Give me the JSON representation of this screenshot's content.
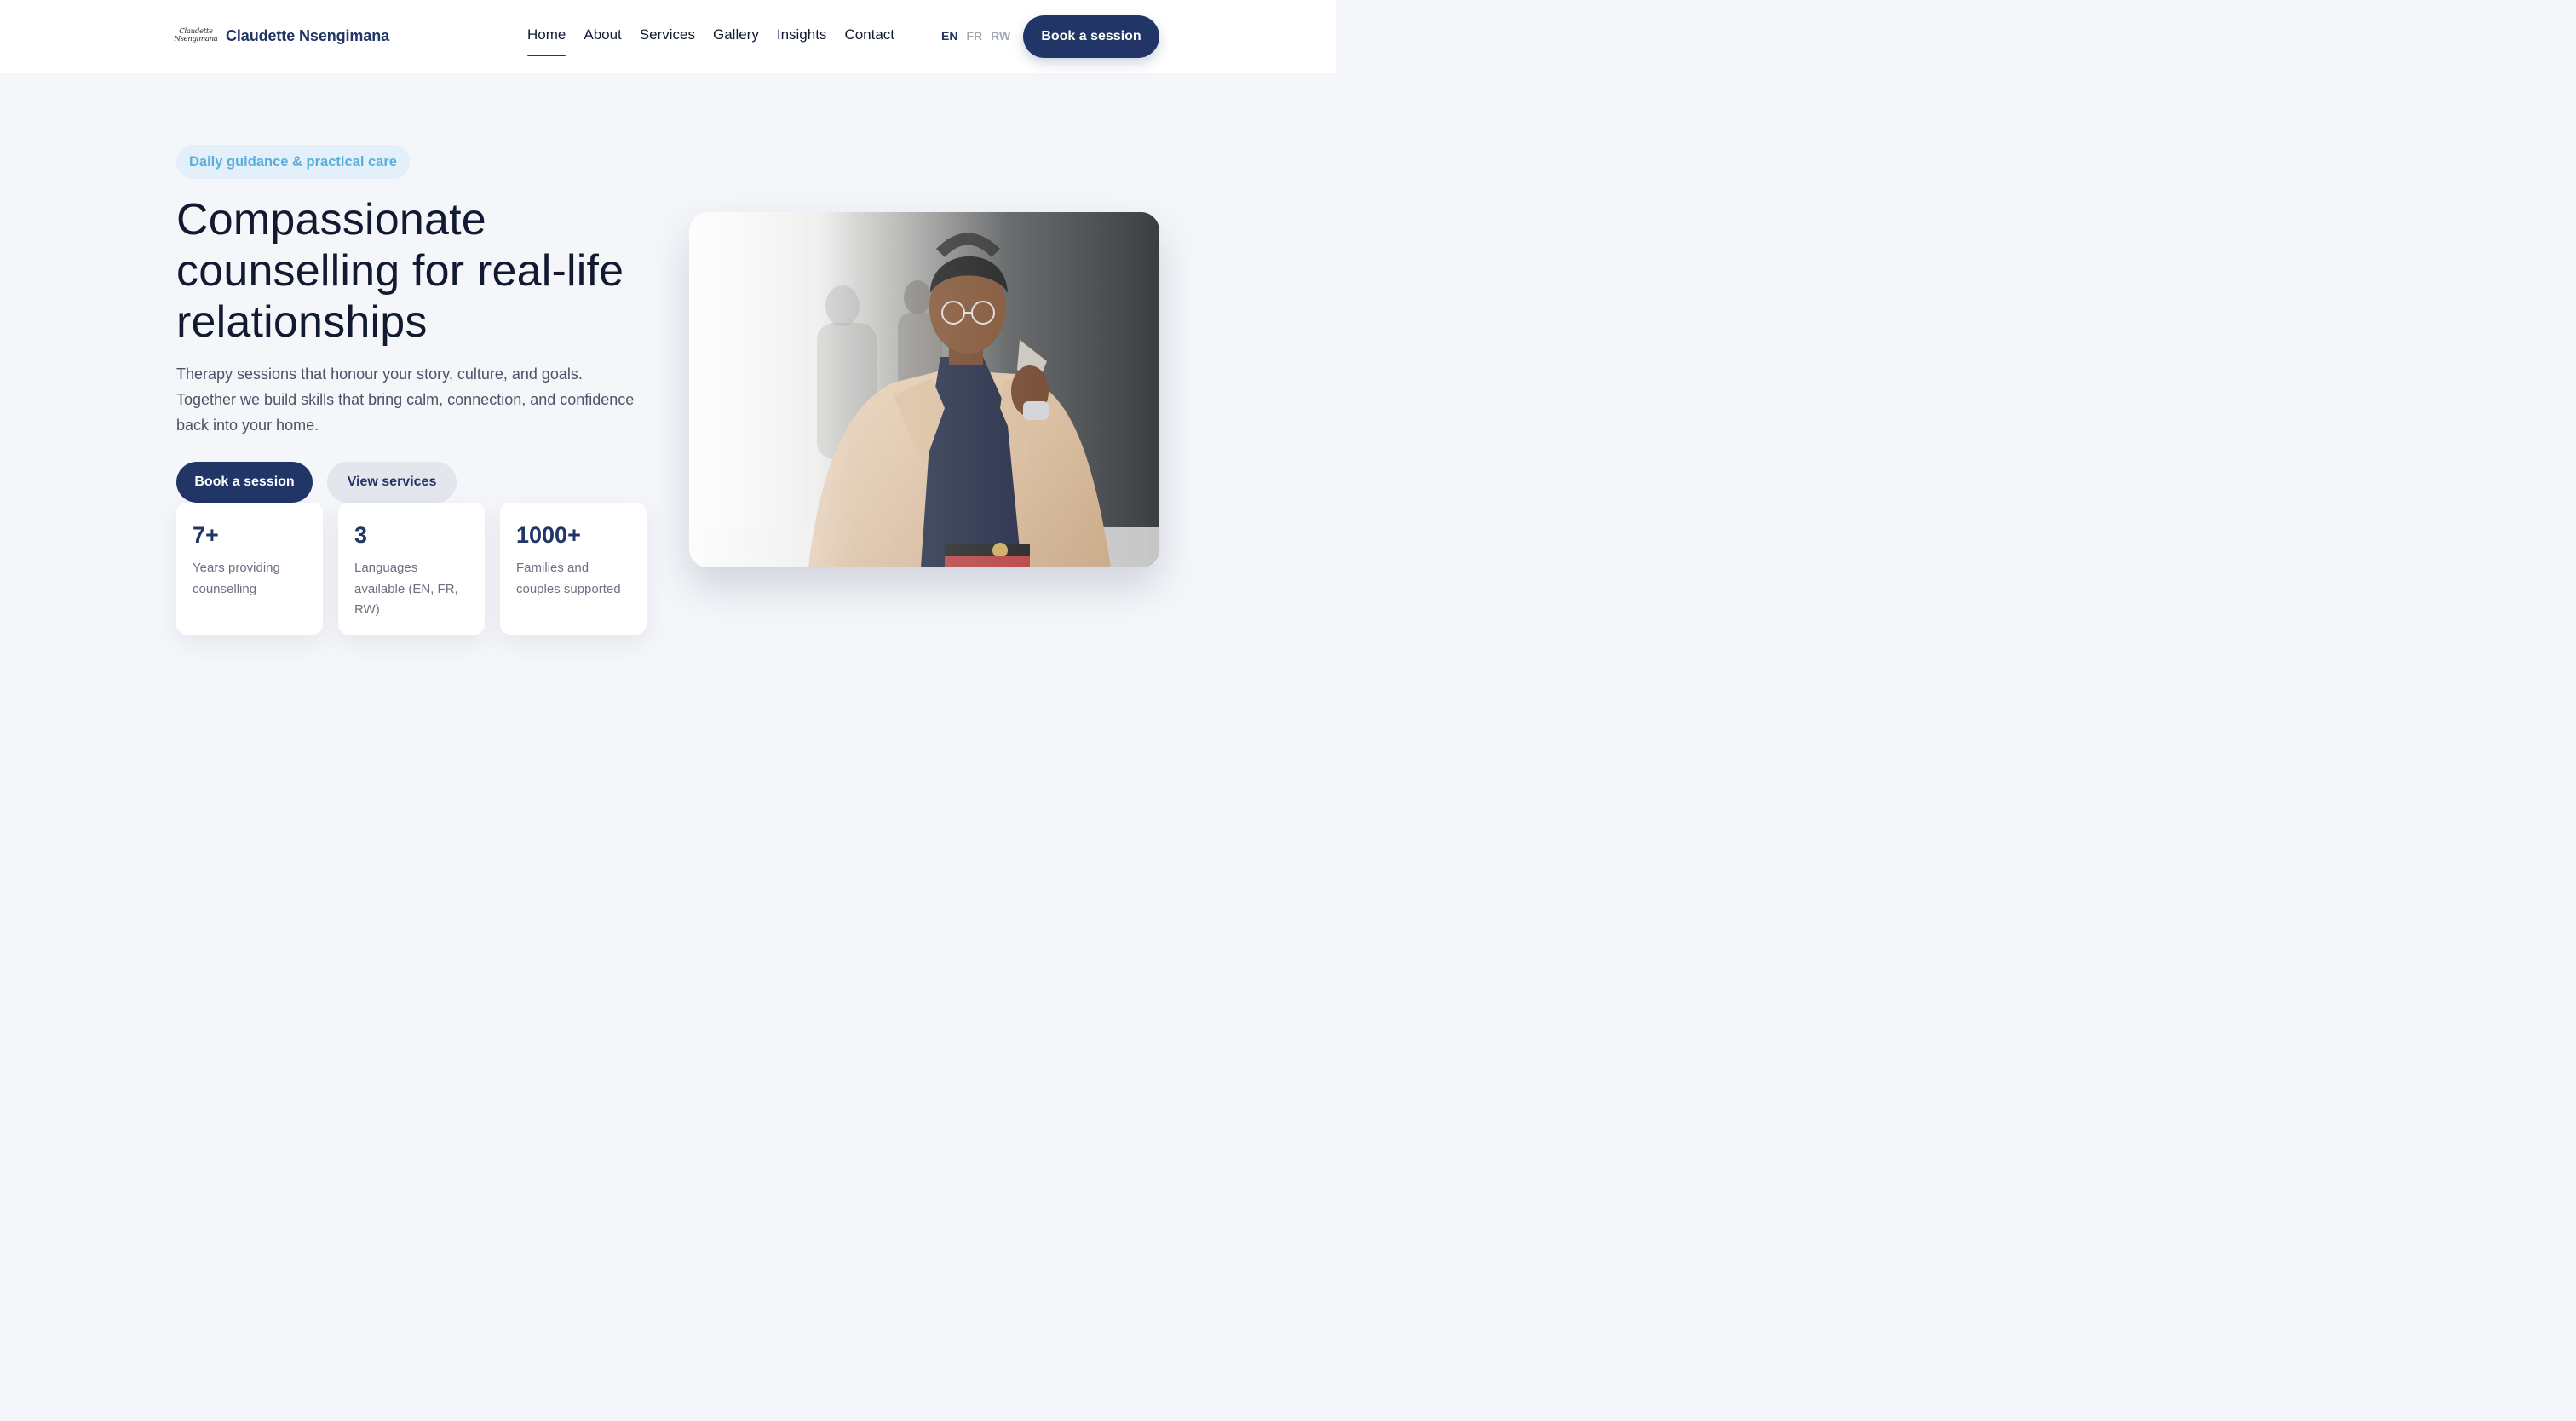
{
  "header": {
    "logo_text": "Claudette Nsengimana",
    "brand_name": "Claudette Nsengimana",
    "nav": [
      {
        "label": "Home",
        "active": true
      },
      {
        "label": "About",
        "active": false
      },
      {
        "label": "Services",
        "active": false
      },
      {
        "label": "Gallery",
        "active": false
      },
      {
        "label": "Insights",
        "active": false
      },
      {
        "label": "Contact",
        "active": false
      }
    ],
    "languages": [
      {
        "label": "EN",
        "active": true
      },
      {
        "label": "FR",
        "active": false
      },
      {
        "label": "RW",
        "active": false
      }
    ],
    "cta_label": "Book a session"
  },
  "hero": {
    "tag": "Daily guidance & practical care",
    "title": "Compassionate counselling for real-life relationships",
    "subtitle": "Therapy sessions that honour your story, culture, and goals. Together we build skills that bring calm, connection, and confidence back into your home.",
    "primary_button": "Book a session",
    "secondary_button": "View services",
    "stats": [
      {
        "value": "7+",
        "label": "Years providing counselling"
      },
      {
        "value": "3",
        "label": "Languages available (EN, FR, RW)"
      },
      {
        "value": "1000+",
        "label": "Families and couples supported"
      }
    ],
    "image_alt": "Portrait of counsellor in a beige trench coat and glasses"
  },
  "colors": {
    "brand_navy": "#213566",
    "page_background": "#f4f6fa",
    "tag_background": "#e3eff9",
    "tag_text": "#5aaedb",
    "secondary_button_bg": "#e3e6ed"
  }
}
